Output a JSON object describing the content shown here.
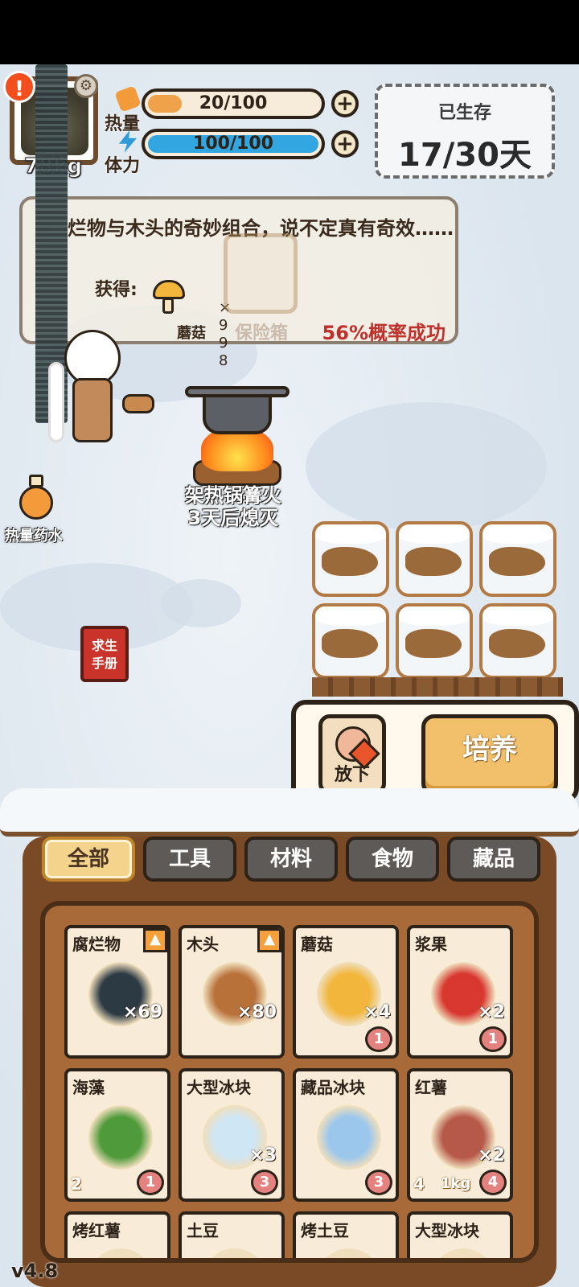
{
  "player": {
    "weight": "78kg",
    "alert": "!",
    "gear_glyph": "⚙"
  },
  "stats": {
    "heat_label": "热量",
    "heat_value": "20/100",
    "heat_fraction": 0.2,
    "stamina_label": "体力",
    "stamina_value": "100/100",
    "stamina_fraction": 1.0,
    "plus_glyph": "+"
  },
  "survival": {
    "label": "已生存",
    "days": "17/30天"
  },
  "tooltip": {
    "description": "烂物与木头的奇妙组合，说不定真有奇效……",
    "gain_label": "获得:",
    "item_name": "蘑菇",
    "item_count": "×998",
    "locked_name": "保险箱",
    "chance": "56%概率成功"
  },
  "campfire": {
    "line1": "架热锅篝火",
    "line2": "3天后熄灭"
  },
  "potion": {
    "label": "热量药水"
  },
  "manual": {
    "label": "求生手册"
  },
  "actions": {
    "drop_label": "放下",
    "train_label": "培养"
  },
  "tabs": [
    {
      "label": "全部",
      "active": true
    },
    {
      "label": "工具",
      "active": false
    },
    {
      "label": "材料",
      "active": false
    },
    {
      "label": "食物",
      "active": false
    },
    {
      "label": "藏品",
      "active": false
    }
  ],
  "inventory": [
    {
      "name": "腐烂物",
      "count": "×69",
      "up": true,
      "color": "#2c3a44"
    },
    {
      "name": "木头",
      "count": "×80",
      "up": true,
      "color": "#b9713a"
    },
    {
      "name": "蘑菇",
      "count": "×4",
      "left": "",
      "badge": "1",
      "color": "#f2b63c"
    },
    {
      "name": "浆果",
      "count": "×2",
      "left": "",
      "badge": "1",
      "color": "#d8382f"
    },
    {
      "name": "海藻",
      "count": "",
      "left": "2",
      "badge": "1",
      "color": "#4f9a3a"
    },
    {
      "name": "大型冰块",
      "count": "×3",
      "left": "",
      "badge": "3",
      "color": "#cfe6f4"
    },
    {
      "name": "藏品冰块",
      "count": "",
      "left": "",
      "badge": "3",
      "color": "#9cc7ec"
    },
    {
      "name": "红薯",
      "count": "×2",
      "left": "4",
      "weight": "1kg",
      "badge": "4",
      "color": "#b6584a"
    },
    {
      "name": "烤红薯",
      "count": "",
      "color": "#f0dfbd"
    },
    {
      "name": "土豆",
      "count": "",
      "color": "#f0dfbd"
    },
    {
      "name": "烤土豆",
      "count": "",
      "color": "#f0dfbd"
    },
    {
      "name": "大型冰块",
      "count": "",
      "color": "#f0dfbd"
    }
  ],
  "version": "v4.8"
}
